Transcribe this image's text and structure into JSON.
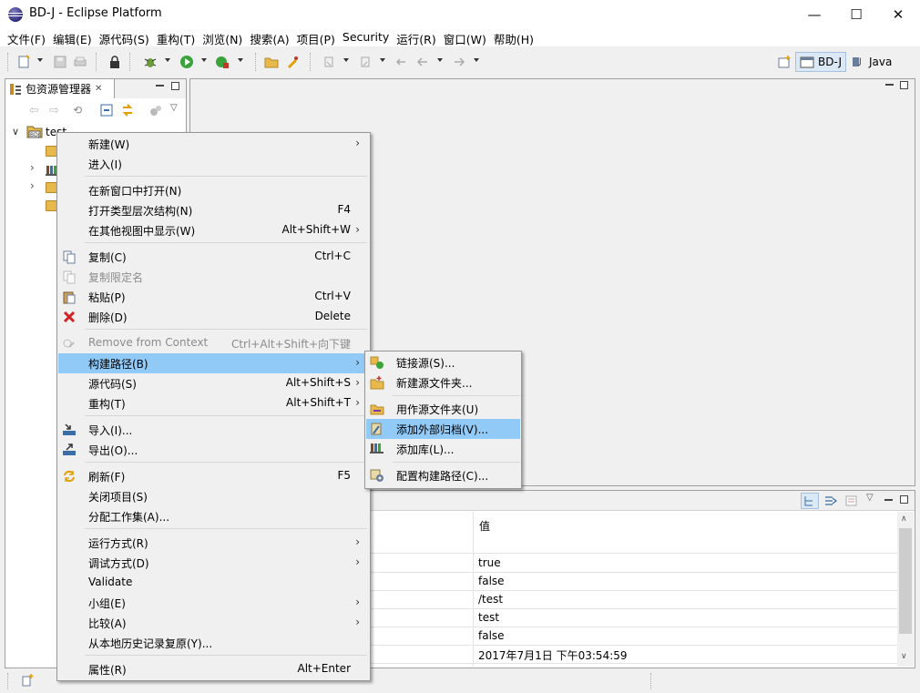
{
  "window": {
    "title": "BD-J - Eclipse Platform",
    "minimize": "—",
    "maximize": "☐",
    "close": "✕"
  },
  "menubar": [
    "文件(F)",
    "编辑(E)",
    "源代码(S)",
    "重构(T)",
    "浏览(N)",
    "搜索(A)",
    "项目(P)",
    "Security",
    "运行(R)",
    "窗口(W)",
    "帮助(H)"
  ],
  "perspectives": {
    "active": "BD-J",
    "other": "Java"
  },
  "package_explorer": {
    "title": "包资源管理器",
    "close_glyph": "✕",
    "project": "test"
  },
  "properties": {
    "value_header": "值",
    "values": [
      "true",
      "false",
      "/test",
      "test",
      "false",
      "2017年7月1日 下午03:54:59"
    ]
  },
  "context_menu": [
    {
      "label": "新建(W)",
      "shortcut": "",
      "submenu": true,
      "icon": ""
    },
    {
      "label": "进入(I)",
      "shortcut": "",
      "submenu": false,
      "icon": ""
    },
    {
      "label": "在新窗口中打开(N)",
      "shortcut": "",
      "submenu": false,
      "icon": ""
    },
    {
      "label": "打开类型层次结构(N)",
      "shortcut": "F4",
      "submenu": false,
      "icon": ""
    },
    {
      "label": "在其他视图中显示(W)",
      "shortcut": "Alt+Shift+W",
      "submenu": true,
      "icon": ""
    },
    {
      "label": "复制(C)",
      "shortcut": "Ctrl+C",
      "submenu": false,
      "icon": "copy-icon"
    },
    {
      "label": "复制限定名",
      "shortcut": "",
      "submenu": false,
      "icon": "copy-qualified-icon",
      "disabled": true
    },
    {
      "label": "粘贴(P)",
      "shortcut": "Ctrl+V",
      "submenu": false,
      "icon": "paste-icon"
    },
    {
      "label": "删除(D)",
      "shortcut": "Delete",
      "submenu": false,
      "icon": "delete-icon"
    },
    {
      "label": "Remove from Context",
      "shortcut": "Ctrl+Alt+Shift+向下键",
      "submenu": false,
      "icon": "remove-context-icon",
      "disabled": true
    },
    {
      "label": "构建路径(B)",
      "shortcut": "",
      "submenu": true,
      "icon": "",
      "highlighted": true
    },
    {
      "label": "源代码(S)",
      "shortcut": "Alt+Shift+S",
      "submenu": true,
      "icon": ""
    },
    {
      "label": "重构(T)",
      "shortcut": "Alt+Shift+T",
      "submenu": true,
      "icon": ""
    },
    {
      "label": "导入(I)...",
      "shortcut": "",
      "submenu": false,
      "icon": "import-icon"
    },
    {
      "label": "导出(O)...",
      "shortcut": "",
      "submenu": false,
      "icon": "export-icon"
    },
    {
      "label": "刷新(F)",
      "shortcut": "F5",
      "submenu": false,
      "icon": "refresh-icon"
    },
    {
      "label": "关闭项目(S)",
      "shortcut": "",
      "submenu": false,
      "icon": ""
    },
    {
      "label": "分配工作集(A)...",
      "shortcut": "",
      "submenu": false,
      "icon": ""
    },
    {
      "label": "运行方式(R)",
      "shortcut": "",
      "submenu": true,
      "icon": ""
    },
    {
      "label": "调试方式(D)",
      "shortcut": "",
      "submenu": true,
      "icon": ""
    },
    {
      "label": "Validate",
      "shortcut": "",
      "submenu": false,
      "icon": ""
    },
    {
      "label": "小组(E)",
      "shortcut": "",
      "submenu": true,
      "icon": ""
    },
    {
      "label": "比较(A)",
      "shortcut": "",
      "submenu": true,
      "icon": ""
    },
    {
      "label": "从本地历史记录复原(Y)...",
      "shortcut": "",
      "submenu": false,
      "icon": ""
    },
    {
      "label": "属性(R)",
      "shortcut": "Alt+Enter",
      "submenu": false,
      "icon": ""
    }
  ],
  "build_path_submenu": [
    {
      "label": "链接源(S)...",
      "icon": "link-source-icon"
    },
    {
      "label": "新建源文件夹...",
      "icon": "new-source-folder-icon"
    },
    {
      "label": "用作源文件夹(U)",
      "icon": "use-as-source-icon"
    },
    {
      "label": "添加外部归档(V)...",
      "icon": "add-external-archive-icon",
      "highlighted": true
    },
    {
      "label": "添加库(L)...",
      "icon": "add-library-icon"
    },
    {
      "label": "配置构建路径(C)...",
      "icon": "configure-build-path-icon"
    }
  ],
  "submenu_arrow": "›"
}
